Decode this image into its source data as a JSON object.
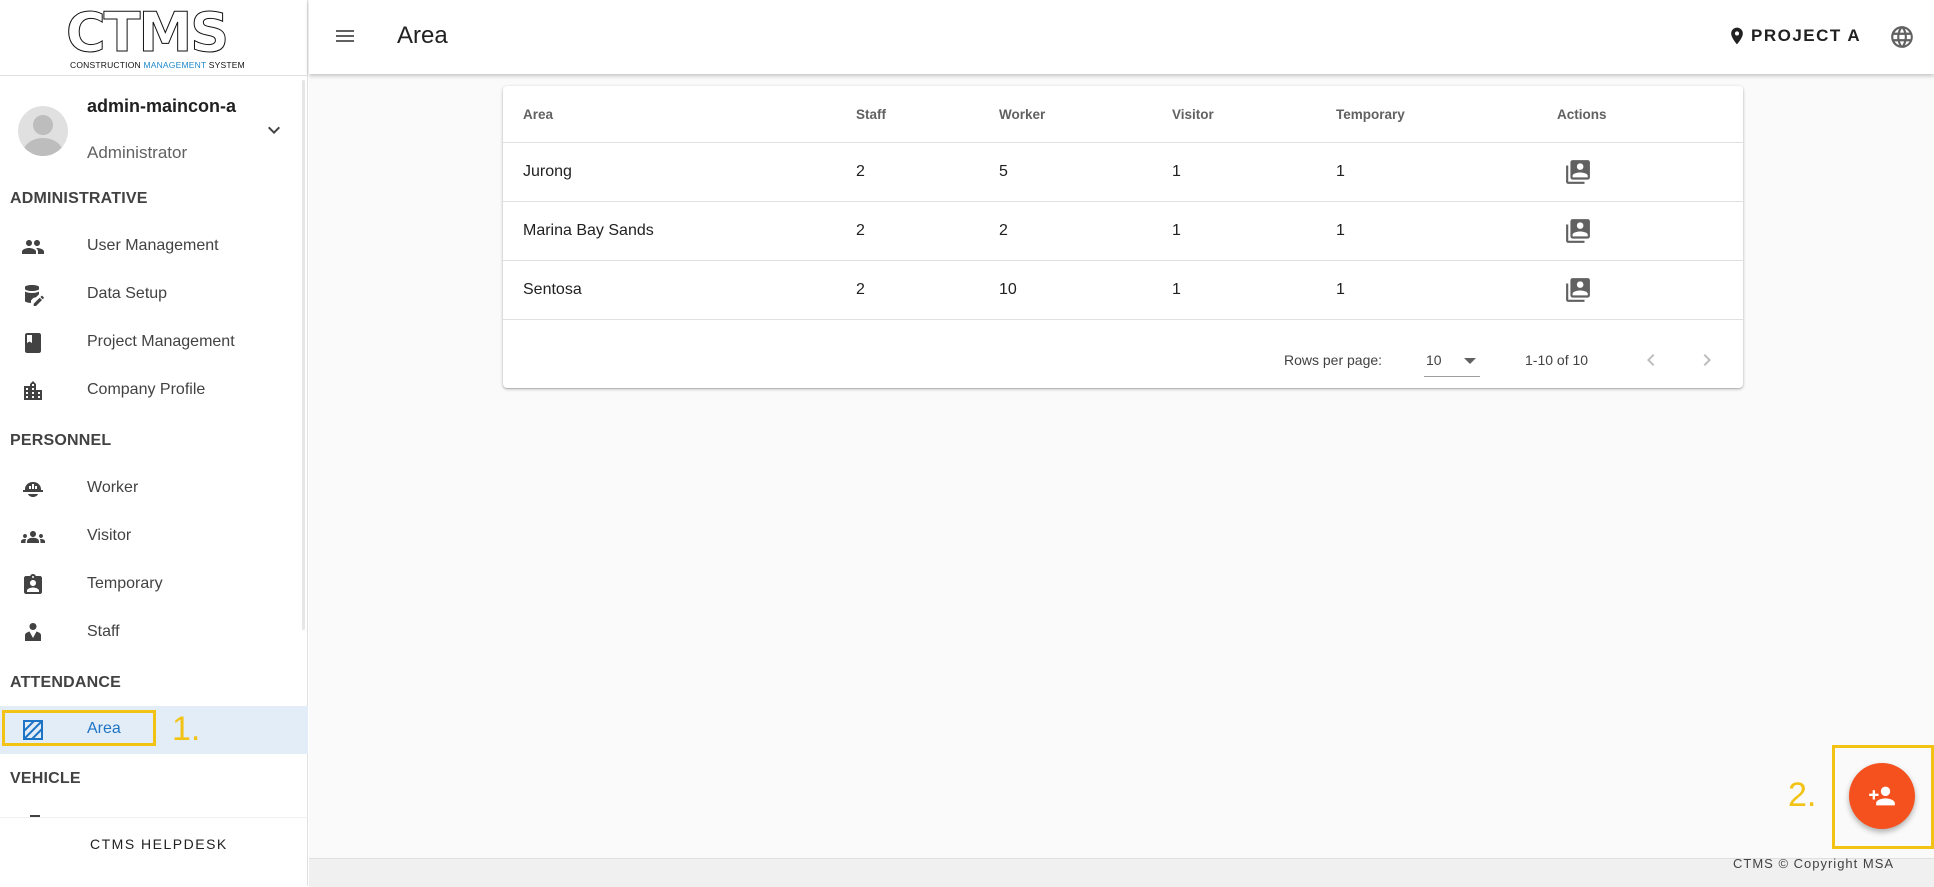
{
  "brand": {
    "logo_text": "CTMS",
    "logo_sub_prefix": "CONSTRUCTION ",
    "logo_sub_accent": "MANAGEMENT",
    "logo_sub_suffix": " SYSTEM",
    "accent_color": "#1e88c9"
  },
  "user": {
    "name": "admin-maincon-a",
    "role": "Administrator"
  },
  "sidebar": {
    "sections": [
      {
        "title": "ADMINISTRATIVE",
        "items": [
          {
            "label": "User Management",
            "icon": "people-icon"
          },
          {
            "label": "Data Setup",
            "icon": "database-edit-icon"
          },
          {
            "label": "Project Management",
            "icon": "book-icon"
          },
          {
            "label": "Company Profile",
            "icon": "building-icon"
          }
        ]
      },
      {
        "title": "PERSONNEL",
        "items": [
          {
            "label": "Worker",
            "icon": "hard-hat-icon"
          },
          {
            "label": "Visitor",
            "icon": "group-icon"
          },
          {
            "label": "Temporary",
            "icon": "badge-icon"
          },
          {
            "label": "Staff",
            "icon": "staff-icon"
          }
        ]
      },
      {
        "title": "ATTENDANCE",
        "items": [
          {
            "label": "Area",
            "icon": "area-icon",
            "active": true
          }
        ]
      },
      {
        "title": "VEHICLE",
        "items": []
      }
    ],
    "helpdesk": "CTMS HELPDESK"
  },
  "header": {
    "title": "Area",
    "project": "PROJECT A"
  },
  "table": {
    "columns": [
      "Area",
      "Staff",
      "Worker",
      "Visitor",
      "Temporary",
      "Actions"
    ],
    "rows": [
      {
        "area": "Jurong",
        "staff": "2",
        "worker": "5",
        "visitor": "1",
        "temporary": "1"
      },
      {
        "area": "Marina Bay Sands",
        "staff": "2",
        "worker": "2",
        "visitor": "1",
        "temporary": "1"
      },
      {
        "area": "Sentosa",
        "staff": "2",
        "worker": "10",
        "visitor": "1",
        "temporary": "1"
      }
    ],
    "pagination": {
      "rows_per_page_label": "Rows per page:",
      "rows_per_page": "10",
      "range": "1-10 of 10"
    }
  },
  "annotations": {
    "one": "1.",
    "two": "2.",
    "highlight_color": "#f2c314"
  },
  "fab": {
    "icon": "add-person-icon",
    "color": "#f4511e"
  },
  "footer": {
    "copyright": "CTMS © Copyright MSA"
  }
}
